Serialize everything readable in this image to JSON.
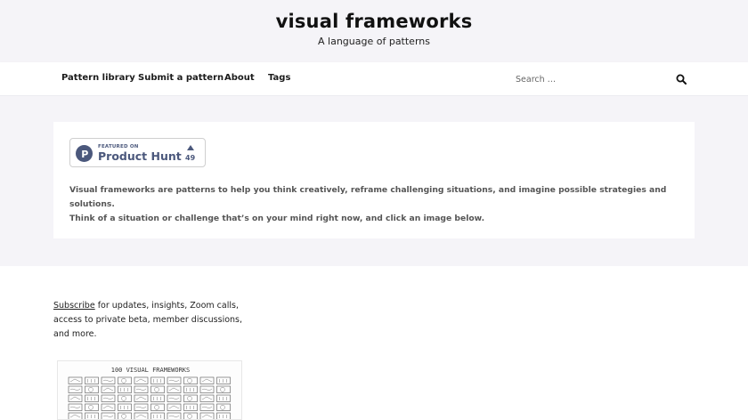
{
  "header": {
    "title": "visual frameworks",
    "tagline": "A language of patterns"
  },
  "nav": {
    "items": [
      {
        "label": "Pattern library"
      },
      {
        "label": "Submit a pattern"
      },
      {
        "label": "About"
      },
      {
        "label": "Tags"
      }
    ],
    "search_placeholder": "Search …",
    "search_icon": "search-icon"
  },
  "featured": {
    "badge_small": "FEATURED ON",
    "badge_name": "Product Hunt",
    "badge_count": "49",
    "badge_color": "#4b587c"
  },
  "intro": {
    "line1": "Visual frameworks are patterns to help you think creatively, reframe challenging situations, and imagine possible strategies and solutions.",
    "line2": "Think of a situation or challenge that’s on your mind right now, and click an image below."
  },
  "subscribe": {
    "link_label": "Subscribe",
    "rest_text": " for updates, insights, Zoom calls, access to private beta, member discussions, and more."
  },
  "poster": {
    "title": "100 VISUAL FRAMEWORKS"
  },
  "colors": {
    "header_bg": "#f5f4f8",
    "band_bg": "#f5f4f8",
    "text": "#222222"
  }
}
